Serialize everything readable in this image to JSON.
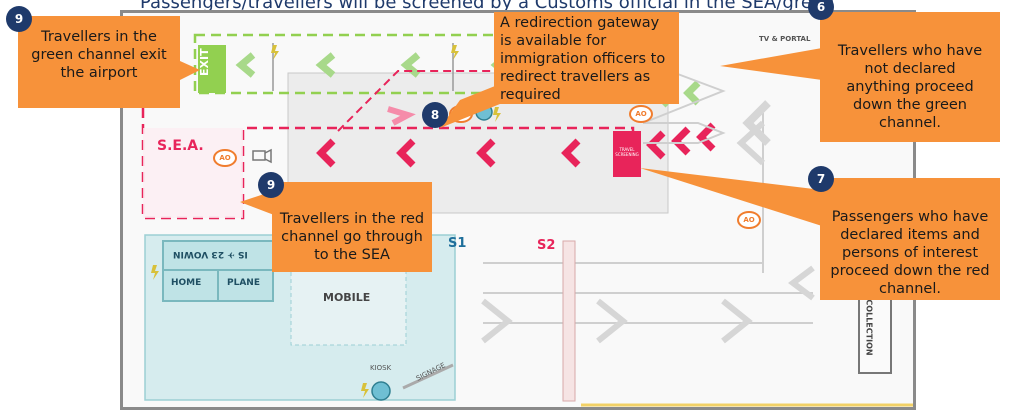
{
  "header": {
    "text": "Passengers/travellers will be screened by a Customs official in the SEA/green channel as part of the..."
  },
  "floorplan": {
    "sea_label": "S.E.A.",
    "s1_label": "S1",
    "s2_label": "S2",
    "exit_label": "EXIT",
    "mobile_label": "MOBILE",
    "kiosk_label": "KIOSK",
    "signage_label": "SIGNAGE",
    "collection_label": "COLLECTION",
    "tv_label": "TV & PORTAL",
    "ao_label": "AO",
    "sign_top": "IS ✈ 2З VOWIN",
    "sign_home": "HOME",
    "sign_plane": "PLANE",
    "red_box_label": "TRAVEL SCREENING"
  },
  "callouts": [
    {
      "badge": "9",
      "text": "Travellers in the green channel exit the airport"
    },
    {
      "badge": "8",
      "text": "A redirection gateway is available for immigration officers to redirect travellers as required"
    },
    {
      "badge": "6",
      "text": "Travellers who have not declared anything proceed down the green channel."
    },
    {
      "badge": "9",
      "text": "Travellers in the red channel go through to the SEA"
    },
    {
      "badge": "7",
      "text": "Passengers who have declared items and persons of interest proceed down the red channel."
    }
  ],
  "colors": {
    "callout": "#f7923a",
    "badge": "#1f3a6b",
    "green_channel": "#92d050",
    "red_channel": "#e8245a",
    "ao": "#f07d2e"
  }
}
